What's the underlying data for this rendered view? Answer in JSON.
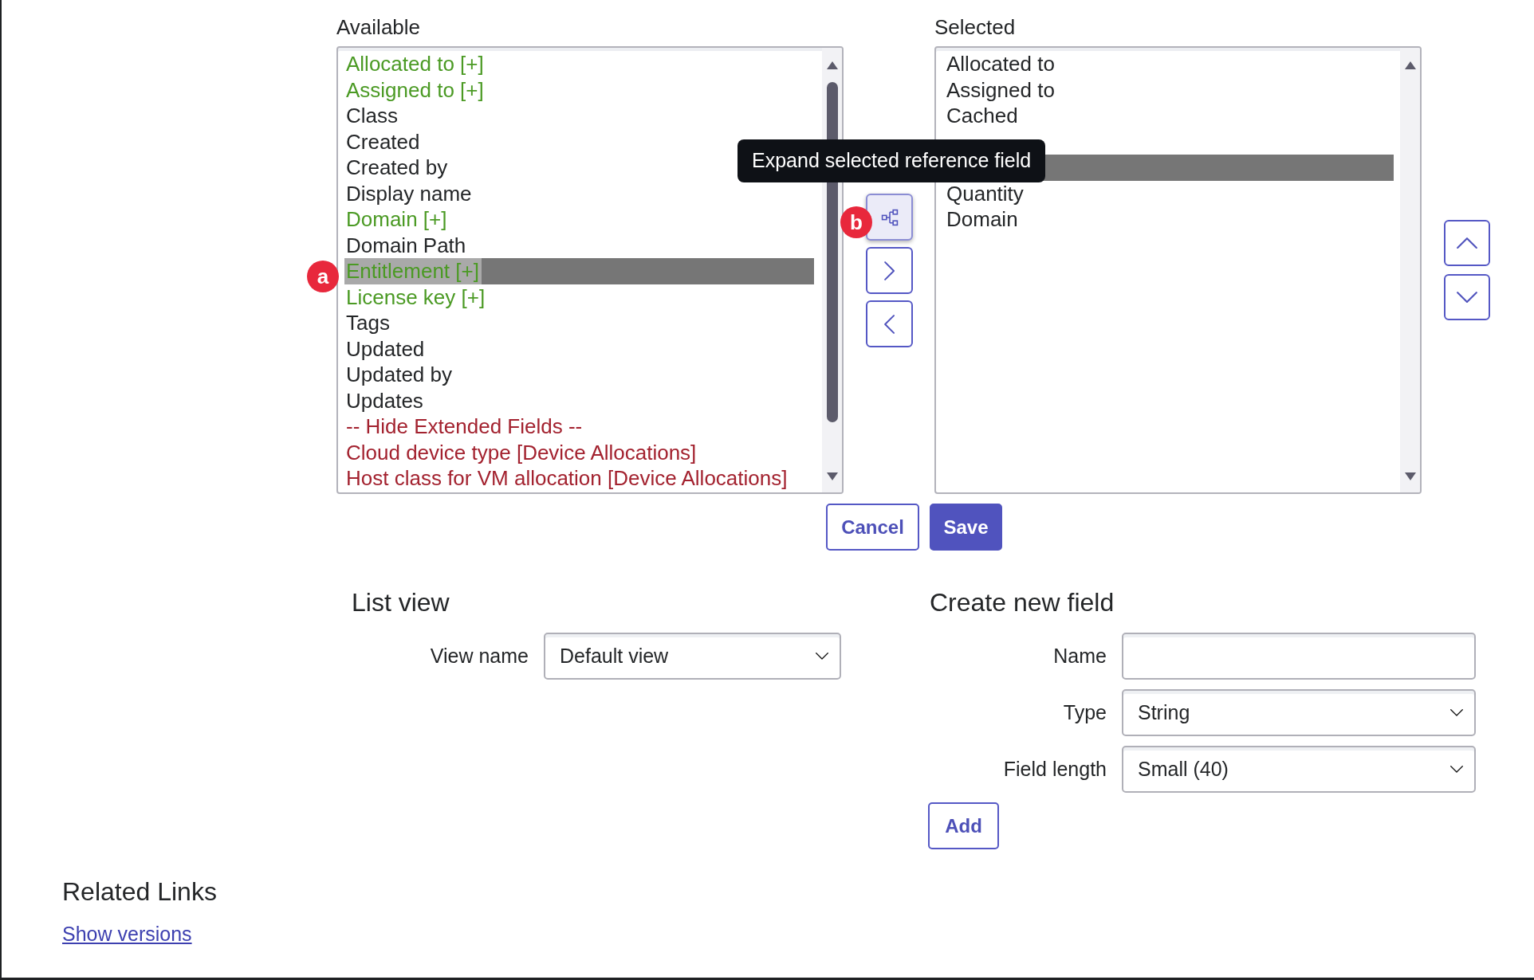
{
  "available": {
    "label": "Available",
    "items": [
      {
        "label": "Allocated to [+]",
        "color": "#4b9a24",
        "selected": false
      },
      {
        "label": "Assigned to [+]",
        "color": "#4b9a24",
        "selected": false
      },
      {
        "label": "Class",
        "color": "#242628",
        "selected": false
      },
      {
        "label": "Created",
        "color": "#242628",
        "selected": false
      },
      {
        "label": "Created by",
        "color": "#242628",
        "selected": false
      },
      {
        "label": "Display name",
        "color": "#242628",
        "selected": false
      },
      {
        "label": "Domain [+]",
        "color": "#4b9a24",
        "selected": false
      },
      {
        "label": "Domain Path",
        "color": "#242628",
        "selected": false
      },
      {
        "label": "Entitlement [+]",
        "color": "#4b9a24",
        "selected": true
      },
      {
        "label": "License key [+]",
        "color": "#4b9a24",
        "selected": false
      },
      {
        "label": "Tags",
        "color": "#242628",
        "selected": false
      },
      {
        "label": "Updated",
        "color": "#242628",
        "selected": false
      },
      {
        "label": "Updated by",
        "color": "#242628",
        "selected": false
      },
      {
        "label": "Updates",
        "color": "#242628",
        "selected": false
      },
      {
        "label": "-- Hide Extended Fields --",
        "color": "#a3222f",
        "selected": false
      },
      {
        "label": "Cloud device type [Device Allocations]",
        "color": "#a3222f",
        "selected": false
      },
      {
        "label": "Host class for VM allocation [Device Allocations]",
        "color": "#a3222f",
        "selected": false
      }
    ]
  },
  "transfer_buttons": [
    {
      "kind": "expand",
      "hovered": true
    },
    {
      "kind": "add",
      "hovered": false
    },
    {
      "kind": "remove",
      "hovered": false
    }
  ],
  "tooltip": {
    "text": "Expand selected reference field"
  },
  "selected": {
    "label": "Selected",
    "items": [
      {
        "label": "Allocated to",
        "selected": false
      },
      {
        "label": "Assigned to",
        "selected": false
      },
      {
        "label": "Cached",
        "selected": false
      },
      {
        "selected": false
      },
      {
        "selected": true
      },
      {
        "label": "Quantity",
        "selected": false
      },
      {
        "label": "Domain",
        "selected": false
      }
    ]
  },
  "order_buttons": [
    {
      "kind": "up"
    },
    {
      "kind": "down"
    }
  ],
  "actions": [
    {
      "kind": "secondary",
      "label": "Cancel"
    },
    {
      "kind": "primary",
      "label": "Save"
    }
  ],
  "list_view": {
    "title": "List view",
    "fields": [
      {
        "label": "View name",
        "kind": "select",
        "value": "Default view"
      }
    ]
  },
  "create_field": {
    "title": "Create new field",
    "fields": [
      {
        "label": "Name",
        "kind": "text"
      },
      {
        "label": "Type",
        "kind": "select",
        "value": "String"
      },
      {
        "label": "Field length",
        "kind": "select",
        "value": "Small (40)"
      }
    ],
    "button": "Add"
  },
  "related_links": {
    "title": "Related Links",
    "links": [
      "Show versions"
    ]
  },
  "annotations": [
    {
      "label": "a"
    },
    {
      "label": "b"
    }
  ]
}
